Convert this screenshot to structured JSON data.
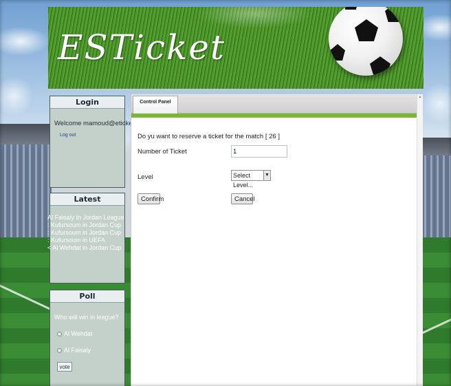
{
  "site": {
    "title": "ESTicket"
  },
  "login": {
    "header": "Login",
    "welcome": "Welcome  mamoud@eticket.com",
    "logout": "Log out"
  },
  "latest": {
    "header": "Latest",
    "items": [
      "Al Faisaly In Jordan League",
      ": Kufursoum in Jordan Cup",
      ": Kufursoum in Jordan Cup",
      ": Kufursoum in UEFA",
      "< Al Wehdat in Jordan Cup"
    ]
  },
  "poll": {
    "header": "Poll",
    "question": "Who will win in league?",
    "options": [
      "Al Wehdat",
      "Al Faisaly"
    ],
    "vote_label": "vote"
  },
  "main": {
    "tab_label": "Control Panel",
    "question": "Do yu want to reserve a ticket for the match [ 26 ]",
    "number_label": "Number of Ticket",
    "number_value": "1",
    "level_label": "Level",
    "level_selected": "Select Level...",
    "confirm_label": "Confirm",
    "cancel_label": "Cancel"
  },
  "colors": {
    "accent": "#7ab534",
    "panel_bg": "#c4d1cb",
    "link": "#1d3f8a"
  },
  "icons": {
    "select_arrow": "chevron-down-icon",
    "scroll_up": "arrow-up-icon",
    "radio": "radio-icon"
  }
}
